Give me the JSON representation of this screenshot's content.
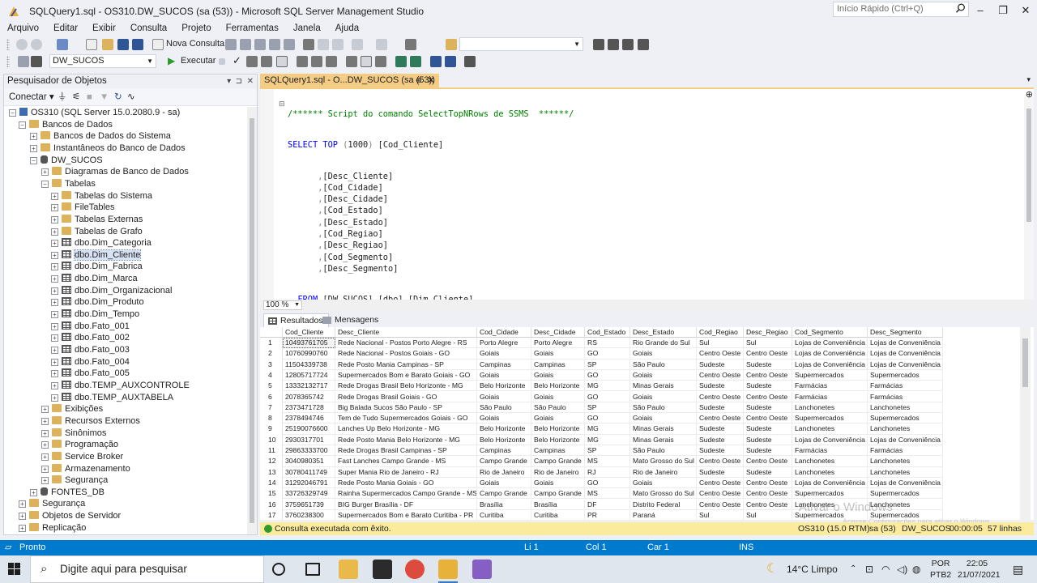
{
  "window": {
    "title": "SQLQuery1.sql - OS310.DW_SUCOS (sa (53)) - Microsoft SQL Server Management Studio",
    "quick_launch_placeholder": "Início Rápido (Ctrl+Q)"
  },
  "menu": [
    "Arquivo",
    "Editar",
    "Exibir",
    "Consulta",
    "Projeto",
    "Ferramentas",
    "Janela",
    "Ajuda"
  ],
  "toolbar": {
    "new_query": "Nova Consulta",
    "database": "DW_SUCOS",
    "execute": "Executar"
  },
  "object_explorer": {
    "title": "Pesquisador de Objetos",
    "connect": "Conectar",
    "tree": [
      {
        "label": "OS310 (SQL Server 15.0.2080.9 - sa)",
        "icon": "server-icon",
        "expander": "-"
      },
      {
        "label": "Bancos de Dados",
        "icon": "folder-icon",
        "expander": "-"
      },
      {
        "label": "Bancos de Dados do Sistema",
        "icon": "folder-icon",
        "expander": "+"
      },
      {
        "label": "Instantâneos do Banco de Dados",
        "icon": "folder-icon",
        "expander": "+"
      },
      {
        "label": "DW_SUCOS",
        "icon": "database-icon",
        "expander": "-"
      },
      {
        "label": "Diagramas de Banco de Dados",
        "icon": "folder-icon",
        "expander": "+"
      },
      {
        "label": "Tabelas",
        "icon": "folder-icon",
        "expander": "-"
      },
      {
        "label": "Tabelas do Sistema",
        "icon": "folder-icon",
        "expander": "+"
      },
      {
        "label": "FileTables",
        "icon": "folder-icon",
        "expander": "+"
      },
      {
        "label": "Tabelas Externas",
        "icon": "folder-icon",
        "expander": "+"
      },
      {
        "label": "Tabelas de Grafo",
        "icon": "folder-icon",
        "expander": "+"
      },
      {
        "label": "dbo.Dim_Categoria",
        "icon": "table-icon",
        "expander": "+"
      },
      {
        "label": "dbo.Dim_Cliente",
        "icon": "table-icon",
        "expander": "+"
      },
      {
        "label": "dbo.Dim_Fabrica",
        "icon": "table-icon",
        "expander": "+"
      },
      {
        "label": "dbo.Dim_Marca",
        "icon": "table-icon",
        "expander": "+"
      },
      {
        "label": "dbo.Dim_Organizacional",
        "icon": "table-icon",
        "expander": "+"
      },
      {
        "label": "dbo.Dim_Produto",
        "icon": "table-icon",
        "expander": "+"
      },
      {
        "label": "dbo.Dim_Tempo",
        "icon": "table-icon",
        "expander": "+"
      },
      {
        "label": "dbo.Fato_001",
        "icon": "table-icon",
        "expander": "+"
      },
      {
        "label": "dbo.Fato_002",
        "icon": "table-icon",
        "expander": "+"
      },
      {
        "label": "dbo.Fato_003",
        "icon": "table-icon",
        "expander": "+"
      },
      {
        "label": "dbo.Fato_004",
        "icon": "table-icon",
        "expander": "+"
      },
      {
        "label": "dbo.Fato_005",
        "icon": "table-icon",
        "expander": "+"
      },
      {
        "label": "dbo.TEMP_AUXCONTROLE",
        "icon": "table-icon",
        "expander": "+"
      },
      {
        "label": "dbo.TEMP_AUXTABELA",
        "icon": "table-icon",
        "expander": "+"
      },
      {
        "label": "Exibições",
        "icon": "folder-icon",
        "expander": "+"
      },
      {
        "label": "Recursos Externos",
        "icon": "folder-icon",
        "expander": "+"
      },
      {
        "label": "Sinônimos",
        "icon": "folder-icon",
        "expander": "+"
      },
      {
        "label": "Programação",
        "icon": "folder-icon",
        "expander": "+"
      },
      {
        "label": "Service Broker",
        "icon": "folder-icon",
        "expander": "+"
      },
      {
        "label": "Armazenamento",
        "icon": "folder-icon",
        "expander": "+"
      },
      {
        "label": "Segurança",
        "icon": "folder-icon",
        "expander": "+"
      },
      {
        "label": "FONTES_DB",
        "icon": "database-icon",
        "expander": "+"
      },
      {
        "label": "Segurança",
        "icon": "folder-icon",
        "expander": "+"
      },
      {
        "label": "Objetos de Servidor",
        "icon": "folder-icon",
        "expander": "+"
      },
      {
        "label": "Replicação",
        "icon": "folder-icon",
        "expander": "+"
      }
    ]
  },
  "document_tab": {
    "label": "SQLQuery1.sql - O...DW_SUCOS (sa (53))"
  },
  "editor": {
    "comment": "/****** Script do comando SelectTopNRows de SSMS  ******/",
    "select_kw": "SELECT",
    "top_kw": "TOP",
    "top_paren_open": "(",
    "top_count": "1000",
    "top_paren_close": ")",
    "first_column": "[Cod_Cliente]",
    "columns": [
      "[Desc_Cliente]",
      "[Cod_Cidade]",
      "[Desc_Cidade]",
      "[Cod_Estado]",
      "[Desc_Estado]",
      "[Cod_Regiao]",
      "[Desc_Regiao]",
      "[Cod_Segmento]",
      "[Desc_Segmento]"
    ],
    "column_comma": ",",
    "from_kw": "FROM",
    "table_ref": "[DW_SUCOS].[dbo].[Dim_Cliente]",
    "zoom": "100 %"
  },
  "results": {
    "tab_results": "Resultados",
    "tab_messages": "Mensagens",
    "columns": [
      "Cod_Cliente",
      "Desc_Cliente",
      "Cod_Cidade",
      "Desc_Cidade",
      "Cod_Estado",
      "Desc_Estado",
      "Cod_Regiao",
      "Desc_Regiao",
      "Cod_Segmento",
      "Desc_Segmento"
    ],
    "rows": [
      [
        "10493761705",
        "Rede Nacional - Postos Porto Alegre - RS",
        "Porto Alegre",
        "Porto Alegre",
        "RS",
        "Rio Grande do Sul",
        "Sul",
        "Sul",
        "Lojas de Conveniência",
        "Lojas de Conveniência"
      ],
      [
        "10760990760",
        "Rede Nacional - Postos Goiais - GO",
        "Goiais",
        "Goiais",
        "GO",
        "Goiais",
        "Centro Oeste",
        "Centro Oeste",
        "Lojas de Conveniência",
        "Lojas de Conveniência"
      ],
      [
        "11504339738",
        "Rede Posto Mania Campinas - SP",
        "Campinas",
        "Campinas",
        "SP",
        "São Paulo",
        "Sudeste",
        "Sudeste",
        "Lojas de Conveniência",
        "Lojas de Conveniência"
      ],
      [
        "12805717724",
        "Supermercados Bom e Barato Goiais - GO",
        "Goiais",
        "Goiais",
        "GO",
        "Goiais",
        "Centro Oeste",
        "Centro Oeste",
        "Supermercados",
        "Supermercados"
      ],
      [
        "13332132717",
        "Rede Drogas Brasil Belo Horizonte - MG",
        "Belo Horizonte",
        "Belo Horizonte",
        "MG",
        "Minas Gerais",
        "Sudeste",
        "Sudeste",
        "Farmácias",
        "Farmácias"
      ],
      [
        "2078365742",
        "Rede Drogas Brasil Goiais - GO",
        "Goiais",
        "Goiais",
        "GO",
        "Goiais",
        "Centro Oeste",
        "Centro Oeste",
        "Farmácias",
        "Farmácias"
      ],
      [
        "2373471728",
        "Big Balada Sucos São Paulo - SP",
        "São Paulo",
        "São Paulo",
        "SP",
        "São Paulo",
        "Sudeste",
        "Sudeste",
        "Lanchonetes",
        "Lanchonetes"
      ],
      [
        "2378494746",
        "Tem de Tudo Supermercados Goiais - GO",
        "Goiais",
        "Goiais",
        "GO",
        "Goiais",
        "Centro Oeste",
        "Centro Oeste",
        "Supermercados",
        "Supermercados"
      ],
      [
        "25190076600",
        "Lanches Up Belo Horizonte - MG",
        "Belo Horizonte",
        "Belo Horizonte",
        "MG",
        "Minas Gerais",
        "Sudeste",
        "Sudeste",
        "Lanchonetes",
        "Lanchonetes"
      ],
      [
        "2930317701",
        "Rede Posto Mania Belo Horizonte - MG",
        "Belo Horizonte",
        "Belo Horizonte",
        "MG",
        "Minas Gerais",
        "Sudeste",
        "Sudeste",
        "Lojas de Conveniência",
        "Lojas de Conveniência"
      ],
      [
        "29863333700",
        "Rede Drogas Brasil Campinas - SP",
        "Campinas",
        "Campinas",
        "SP",
        "São Paulo",
        "Sudeste",
        "Sudeste",
        "Farmácias",
        "Farmácias"
      ],
      [
        "3040980351",
        "Fast Lanches Campo Grande - MS",
        "Campo Grande",
        "Campo Grande",
        "MS",
        "Mato Grosso do Sul",
        "Centro Oeste",
        "Centro Oeste",
        "Lanchonetes",
        "Lanchonetes"
      ],
      [
        "30780411749",
        "Super Mania Rio de Janeiro - RJ",
        "Rio de Janeiro",
        "Rio de Janeiro",
        "RJ",
        "Rio de Janeiro",
        "Sudeste",
        "Sudeste",
        "Lanchonetes",
        "Lanchonetes"
      ],
      [
        "31292046791",
        "Rede Posto Mania Goiais - GO",
        "Goiais",
        "Goiais",
        "GO",
        "Goiais",
        "Centro Oeste",
        "Centro Oeste",
        "Lojas de Conveniência",
        "Lojas de Conveniência"
      ],
      [
        "33726329749",
        "Rainha Supermercados Campo Grande - MS",
        "Campo Grande",
        "Campo Grande",
        "MS",
        "Mato Grosso do Sul",
        "Centro Oeste",
        "Centro Oeste",
        "Supermercados",
        "Supermercados"
      ],
      [
        "3759651739",
        "BIG Burger Brasília - DF",
        "Brasília",
        "Brasília",
        "DF",
        "Distrito Federal",
        "Centro Oeste",
        "Centro Oeste",
        "Lanchonetes",
        "Lanchonetes"
      ],
      [
        "3760238300",
        "Supermercados Bom e Barato Curitiba - PR",
        "Curitiba",
        "Curitiba",
        "PR",
        "Paraná",
        "Sul",
        "Sul",
        "Supermercados",
        "Supermercados"
      ]
    ],
    "watermark": "Ativar o Windows",
    "watermark_sub": "Acesse Configurações para ativar o Windows."
  },
  "query_status": {
    "message": "Consulta executada com êxito.",
    "server": "OS310 (15.0 RTM)",
    "user": "sa (53)",
    "database": "DW_SUCOS",
    "elapsed": "00:00:05",
    "rows": "57 linhas"
  },
  "statusbar": {
    "state": "Pronto",
    "line": "Li 1",
    "col": "Col 1",
    "car": "Car 1",
    "mode": "INS"
  },
  "taskbar": {
    "search_placeholder": "Digite aqui para pesquisar",
    "weather": "14°C  Limpo",
    "language_top": "POR",
    "language_bottom": "PTB2",
    "time": "22:05",
    "date": "21/07/2021"
  },
  "colors": {
    "accent": "#007acc",
    "tab_active": "#f5cc84",
    "status_query": "#fbec9d",
    "keyword": "#0000ff",
    "comment": "#008000"
  }
}
